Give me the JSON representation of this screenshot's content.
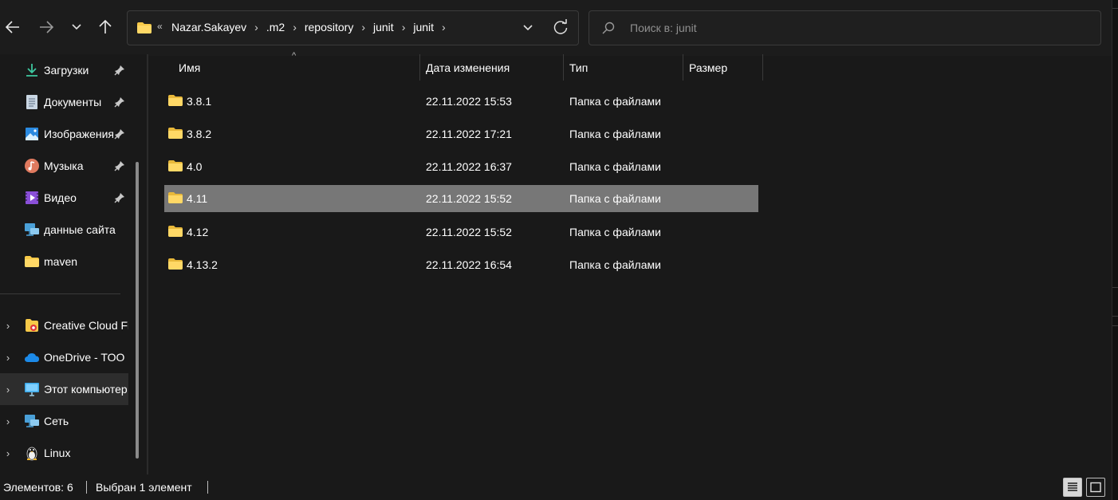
{
  "nav": {
    "back_icon": "arrow-left-icon",
    "forward_icon": "arrow-right-icon",
    "recent_icon": "chevron-down-icon",
    "up_icon": "arrow-up-icon"
  },
  "address": {
    "overflow": "«",
    "crumbs": [
      "Nazar.Sakayev",
      ".m2",
      "repository",
      "junit",
      "junit"
    ],
    "chevron": "›"
  },
  "search": {
    "placeholder": "Поиск в: junit"
  },
  "sidebar": {
    "quick_access": [
      {
        "label": "Загрузки",
        "icon": "download-icon",
        "pinned": true
      },
      {
        "label": "Документы",
        "icon": "documents-icon",
        "pinned": true
      },
      {
        "label": "Изображения",
        "icon": "pictures-icon",
        "pinned": true
      },
      {
        "label": "Музыка",
        "icon": "music-icon",
        "pinned": true
      },
      {
        "label": "Видео",
        "icon": "video-icon",
        "pinned": true
      },
      {
        "label": "данные сайта",
        "icon": "network-folder-icon",
        "pinned": false
      },
      {
        "label": "maven",
        "icon": "folder-icon",
        "pinned": false
      }
    ],
    "locations": [
      {
        "label": "Creative Cloud Files",
        "icon": "creative-cloud-icon",
        "selected": false
      },
      {
        "label": "OneDrive - TOO",
        "icon": "onedrive-icon",
        "selected": false
      },
      {
        "label": "Этот компьютер",
        "icon": "computer-icon",
        "selected": true
      },
      {
        "label": "Сеть",
        "icon": "network-icon",
        "selected": false
      },
      {
        "label": "Linux",
        "icon": "linux-icon",
        "selected": false
      }
    ]
  },
  "columns": {
    "name": "Имя",
    "date": "Дата изменения",
    "type": "Тип",
    "size": "Размер"
  },
  "files": [
    {
      "name": "3.8.1",
      "date": "22.11.2022 15:53",
      "type": "Папка с файлами",
      "size": "",
      "selected": false
    },
    {
      "name": "3.8.2",
      "date": "22.11.2022 17:21",
      "type": "Папка с файлами",
      "size": "",
      "selected": false
    },
    {
      "name": "4.0",
      "date": "22.11.2022 16:37",
      "type": "Папка с файлами",
      "size": "",
      "selected": false
    },
    {
      "name": "4.11",
      "date": "22.11.2022 15:52",
      "type": "Папка с файлами",
      "size": "",
      "selected": true
    },
    {
      "name": "4.12",
      "date": "22.11.2022 15:52",
      "type": "Папка с файлами",
      "size": "",
      "selected": false
    },
    {
      "name": "4.13.2",
      "date": "22.11.2022 16:54",
      "type": "Папка с файлами",
      "size": "",
      "selected": false
    }
  ],
  "status": {
    "count": "Элементов: 6",
    "selection": "Выбран 1 элемент"
  },
  "colors": {
    "background": "#191919",
    "selected_row": "#777777",
    "folder_yellow": "#f7c948"
  }
}
